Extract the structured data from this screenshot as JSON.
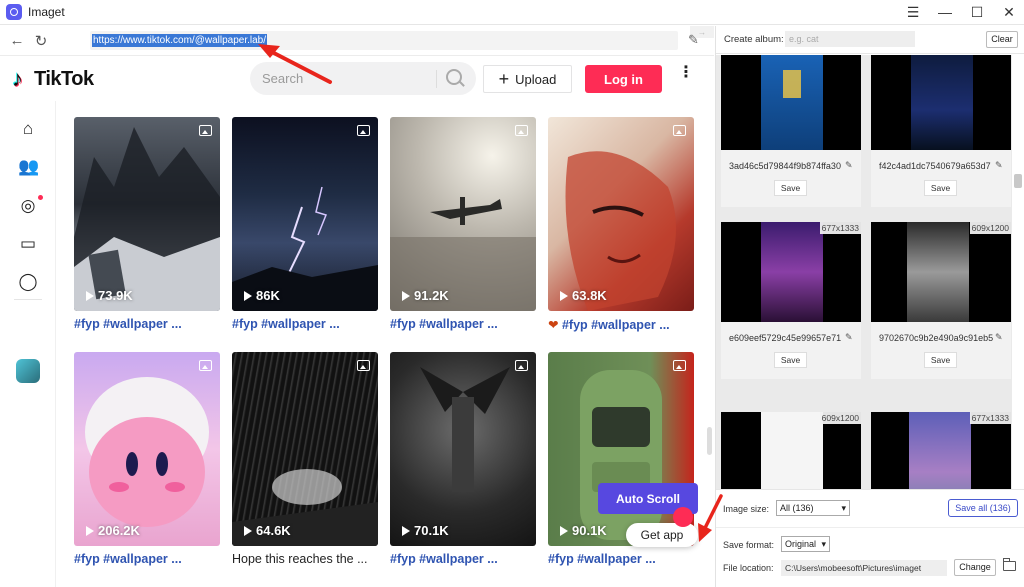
{
  "app": {
    "title": "Imaget"
  },
  "window_controls": {
    "menu": "☰",
    "minimize": "—",
    "maximize": "☐",
    "close": "✕"
  },
  "browser": {
    "url": "https://www.tiktok.com/@wallpaper.lab/"
  },
  "tiktok": {
    "logo_text": "TikTok",
    "search_placeholder": "Search",
    "upload_label": "Upload",
    "login_label": "Log in",
    "get_app_label": "Get app",
    "videos": [
      {
        "views": "73.9K",
        "caption": "#fyp #wallpaper ..."
      },
      {
        "views": "86K",
        "caption": "#fyp #wallpaper ..."
      },
      {
        "views": "91.2K",
        "caption": "#fyp #wallpaper ..."
      },
      {
        "views": "63.8K",
        "caption": "#fyp #wallpaper ..."
      },
      {
        "views": "206.2K",
        "caption": "#fyp #wallpaper ..."
      },
      {
        "views": "64.6K",
        "caption": "Hope this reaches the ..."
      },
      {
        "views": "70.1K",
        "caption": "#fyp #wallpaper ..."
      },
      {
        "views": "90.1K",
        "caption": "#fyp #wallpaper ..."
      }
    ]
  },
  "auto_scroll_label": "Auto Scroll",
  "panel": {
    "album_label": "Create album:",
    "album_placeholder": "e.g. cat",
    "clear_label": "Clear",
    "save_label": "Save",
    "images": [
      {
        "name": "3ad46c5d79844f9b874ffa30",
        "dims": ""
      },
      {
        "name": "f42c4ad1dc7540679a653d7",
        "dims": ""
      },
      {
        "name": "e609eef5729c45e99657e71",
        "dims": "677x1333"
      },
      {
        "name": "9702670c9b2e490a9c91eb5",
        "dims": "609x1200"
      },
      {
        "name": "",
        "dims": "609x1200"
      },
      {
        "name": "",
        "dims": "677x1333"
      }
    ],
    "image_size_label": "Image size:",
    "image_size_value": "All (136)",
    "save_all_label": "Save all (136)",
    "save_format_label": "Save format:",
    "save_format_value": "Original",
    "file_location_label": "File location:",
    "file_location_value": "C:\\Users\\mobeesoft\\Pictures\\imaget",
    "change_label": "Change"
  },
  "colors": {
    "accent": "#5748e0",
    "tiktok_red": "#fe2c55",
    "link_blue": "#2f54b1"
  }
}
